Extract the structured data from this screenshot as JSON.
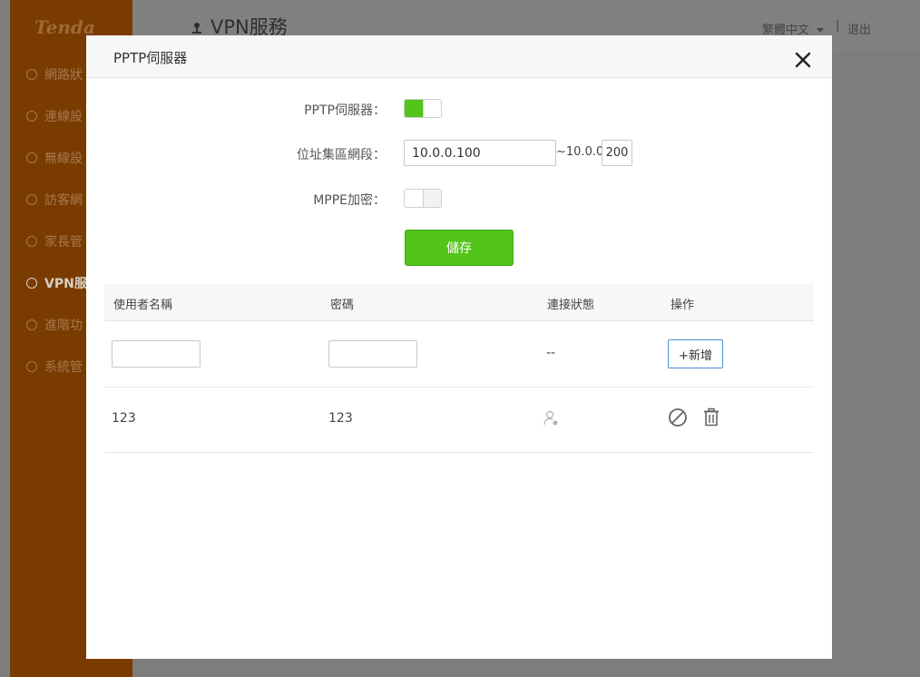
{
  "background": {
    "logo": "Tenda",
    "page_title": "VPN服務",
    "language": "繁體中文",
    "separator": "|",
    "logout": "退出",
    "nav": [
      {
        "label": "網路狀",
        "icon": "network-status-icon"
      },
      {
        "label": "連線設",
        "icon": "globe-icon"
      },
      {
        "label": "無線設",
        "icon": "wifi-icon"
      },
      {
        "label": "訪客網",
        "icon": "guest-network-icon"
      },
      {
        "label": "家長管",
        "icon": "parental-control-icon"
      },
      {
        "label": "VPN服",
        "icon": "vpn-icon"
      },
      {
        "label": "進階功",
        "icon": "wrench-icon"
      },
      {
        "label": "系統管",
        "icon": "gear-icon"
      }
    ]
  },
  "modal": {
    "title": "PPTP伺服器",
    "form": {
      "pptp_label": "PPTP伺服器：",
      "pptp_enabled": true,
      "pool_label": "位址集區網段：",
      "pool_start": "10.0.0.100",
      "pool_mid": "~10.0.0.",
      "pool_end": "200",
      "mppe_label": "MPPE加密：",
      "mppe_enabled": false,
      "save_label": "儲存"
    },
    "table": {
      "headers": [
        "使用者名稱",
        "密碼",
        "連接狀態",
        "操作"
      ],
      "new_row": {
        "username_value": "",
        "password_value": "",
        "status": "--",
        "add_label": "+新增"
      },
      "rows": [
        {
          "username": "123",
          "password": "123",
          "status_icon": "user-offline-icon",
          "actions": [
            "disable-icon",
            "trash-icon"
          ]
        }
      ]
    }
  },
  "colors": {
    "accent_green": "#52c41a",
    "sidebar_orange": "#7a3b00",
    "overlay": "#7d7d7d",
    "add_border": "#4a90d9"
  }
}
